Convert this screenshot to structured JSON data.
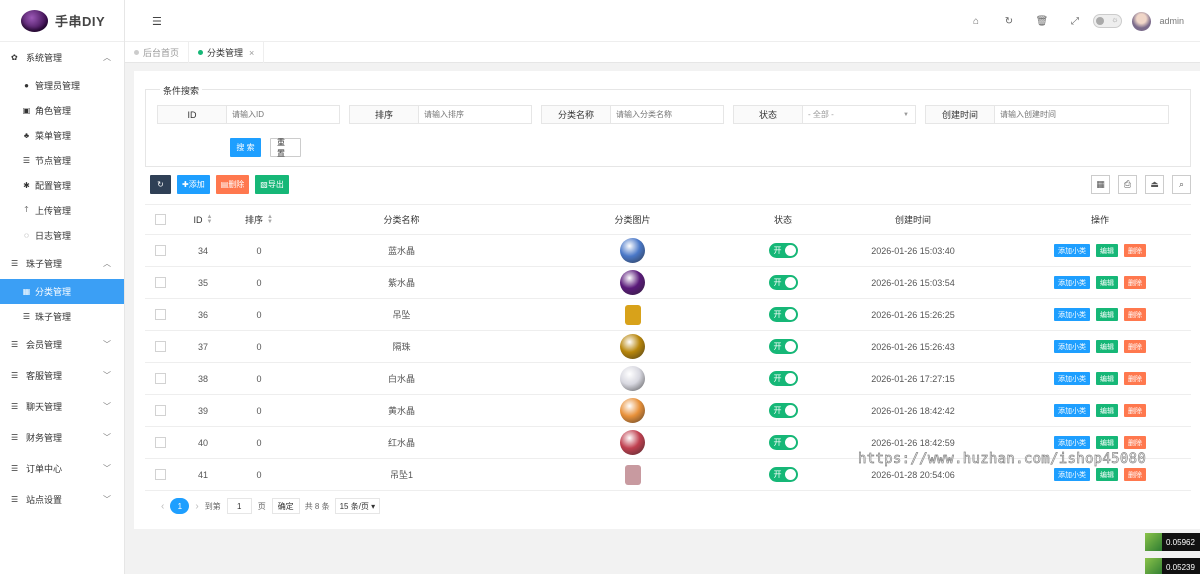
{
  "app": {
    "title": "手串DIY"
  },
  "sidebar": {
    "groups": [
      {
        "label": "系统管理",
        "icon": "gear-icon",
        "expanded": true,
        "items": [
          {
            "label": "管理员管理",
            "icon": "user-icon"
          },
          {
            "label": "角色管理",
            "icon": "role-icon"
          },
          {
            "label": "菜单管理",
            "icon": "tree-icon"
          },
          {
            "label": "节点管理",
            "icon": "list-icon"
          },
          {
            "label": "配置管理",
            "icon": "asterisk-icon"
          },
          {
            "label": "上传管理",
            "icon": "arrow-up-icon"
          },
          {
            "label": "日志管理",
            "icon": "clock-icon"
          }
        ]
      },
      {
        "label": "珠子管理",
        "icon": "list-icon",
        "expanded": true,
        "items": [
          {
            "label": "分类管理",
            "icon": "calendar-icon",
            "active": true
          },
          {
            "label": "珠子管理",
            "icon": "list-icon"
          }
        ]
      },
      {
        "label": "会员管理",
        "icon": "list-icon"
      },
      {
        "label": "客服管理",
        "icon": "list-icon"
      },
      {
        "label": "聊天管理",
        "icon": "list-icon"
      },
      {
        "label": "财务管理",
        "icon": "list-icon"
      },
      {
        "label": "订单中心",
        "icon": "list-icon"
      },
      {
        "label": "站点设置",
        "icon": "list-icon"
      }
    ]
  },
  "header": {
    "username": "admin"
  },
  "tabs": [
    {
      "label": "后台首页",
      "active": false
    },
    {
      "label": "分类管理",
      "active": true,
      "close": "×"
    }
  ],
  "search": {
    "legend": "条件搜索",
    "fields": [
      {
        "label": "ID",
        "placeholder": "请输入ID"
      },
      {
        "label": "排序",
        "placeholder": "请输入排序"
      },
      {
        "label": "分类名称",
        "placeholder": "请输入分类名称"
      },
      {
        "label": "状态",
        "value": "- 全部 -"
      },
      {
        "label": "创建时间",
        "placeholder": "请输入创建时间"
      }
    ],
    "search_label": "搜 索",
    "reset_label": "重 置"
  },
  "toolbar": {
    "add_label": "添加",
    "delete_label": "删除",
    "export_label": "导出"
  },
  "table": {
    "columns": [
      "ID",
      "排序",
      "分类名称",
      "分类图片",
      "状态",
      "创建时间",
      "操作"
    ],
    "rows": [
      {
        "id": "34",
        "sort": "0",
        "name": "蓝水晶",
        "image": "blue-crystal-bead",
        "color": "#4a78c8",
        "status": "开",
        "time": "2026-01-26 15:03:40"
      },
      {
        "id": "35",
        "sort": "0",
        "name": "紫水晶",
        "image": "purple-crystal-bead",
        "color": "#5a1a7a",
        "status": "开",
        "time": "2026-01-26 15:03:54"
      },
      {
        "id": "36",
        "sort": "0",
        "name": "吊坠",
        "image": "gold-pendant",
        "color": "#d8a21a",
        "status": "开",
        "time": "2026-01-26 15:26:25"
      },
      {
        "id": "37",
        "sort": "0",
        "name": "隔珠",
        "image": "gold-spacer-bead",
        "color": "#b8860b",
        "status": "开",
        "time": "2026-01-26 15:26:43"
      },
      {
        "id": "38",
        "sort": "0",
        "name": "白水晶",
        "image": "white-crystal-bead",
        "color": "#d8d8e0",
        "status": "开",
        "time": "2026-01-26 17:27:15"
      },
      {
        "id": "39",
        "sort": "0",
        "name": "黄水晶",
        "image": "citrine-bead",
        "color": "#e8913a",
        "status": "开",
        "time": "2026-01-26 18:42:42"
      },
      {
        "id": "40",
        "sort": "0",
        "name": "红水晶",
        "image": "red-crystal-bead",
        "color": "#c04050",
        "status": "开",
        "time": "2026-01-26 18:42:59"
      },
      {
        "id": "41",
        "sort": "0",
        "name": "吊坠1",
        "image": "charm-pendant",
        "color": "#c89aa0",
        "status": "开",
        "time": "2026-01-28 20:54:06"
      }
    ],
    "ops": {
      "add_sub": "添加小类",
      "edit": "编辑",
      "delete": "删除"
    }
  },
  "pager": {
    "current": "1",
    "goto_prefix": "到第",
    "goto_value": "1",
    "goto_suffix": "页",
    "confirm": "确定",
    "total": "共 8 条",
    "page_size": "15 条/页"
  },
  "watermark": "https://www.huzhan.com/ishop45080",
  "stats": [
    "0.05962",
    "0.05239"
  ]
}
